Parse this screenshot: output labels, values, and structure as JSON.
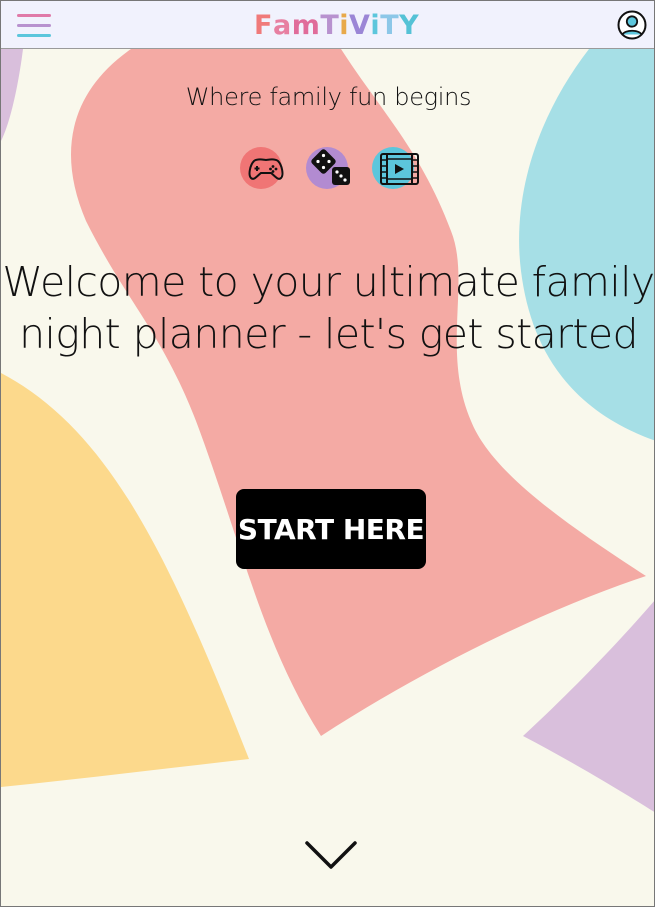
{
  "header": {
    "logo_letters": [
      {
        "char": "F",
        "color": "#f07a7a"
      },
      {
        "char": "a",
        "color": "#e77fa1"
      },
      {
        "char": "m",
        "color": "#e06c9a"
      },
      {
        "char": "T",
        "color": "#b892cf"
      },
      {
        "char": "i",
        "color": "#e8a94a"
      },
      {
        "char": "V",
        "color": "#9b86d6"
      },
      {
        "char": "i",
        "color": "#5cc6dc"
      },
      {
        "char": "T",
        "color": "#8cc7e8"
      },
      {
        "char": "Y",
        "color": "#55c2d6"
      }
    ],
    "menu_icon": "hamburger-menu-icon",
    "profile_icon": "user-profile-icon",
    "menu_colors": [
      "#e07aa8",
      "#b892cf",
      "#5cc6dc"
    ]
  },
  "hero": {
    "tagline": "Where family fun begins",
    "activity_icons": [
      {
        "name": "game-controller-icon",
        "bg": "#f07575"
      },
      {
        "name": "dice-icon",
        "bg": "#b28bd1"
      },
      {
        "name": "film-video-icon",
        "bg": "#5cc6dc"
      }
    ],
    "headline_line1": "Welcome to your ultimate family",
    "headline_line2": "night planner - let's get started",
    "cta_label": "START HERE",
    "scroll_icon": "chevron-down-icon"
  },
  "colors": {
    "background": "#f9f8ec",
    "blob_pink": "#f4aaa4",
    "blob_blue": "#a6dfe6",
    "blob_yellow": "#fcd98c",
    "blob_purple": "#d9bfdc"
  }
}
